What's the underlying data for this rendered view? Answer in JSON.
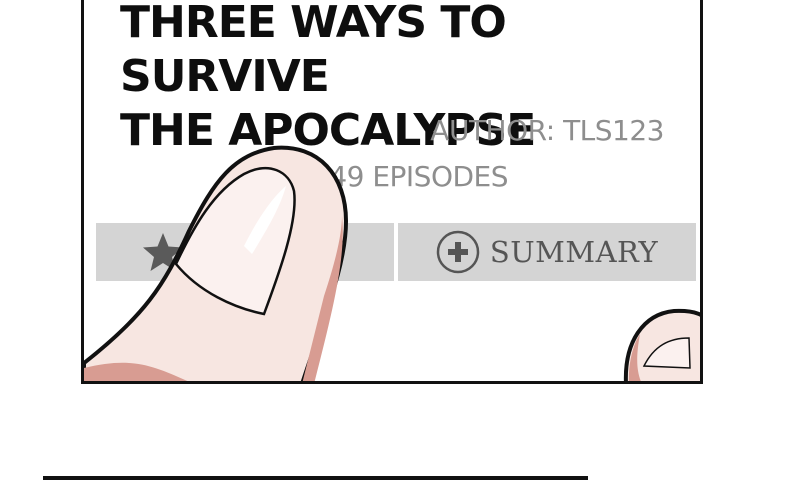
{
  "title": {
    "line1": "THREE WAYS TO SURVIVE",
    "line2": "THE APOCALYPSE"
  },
  "author": "AUTHOR: TLS123",
  "episodes": "149 EPISODES",
  "buttons": {
    "favorite": {
      "icon": "star-icon"
    },
    "summary": {
      "icon": "plus-circle-icon",
      "label": "SUMMARY"
    }
  },
  "colors": {
    "button_bg": "#d4d4d4",
    "meta_text": "#8e8e8e",
    "skin": "#f7e6e1",
    "skin_shadow": "#d89c92"
  }
}
